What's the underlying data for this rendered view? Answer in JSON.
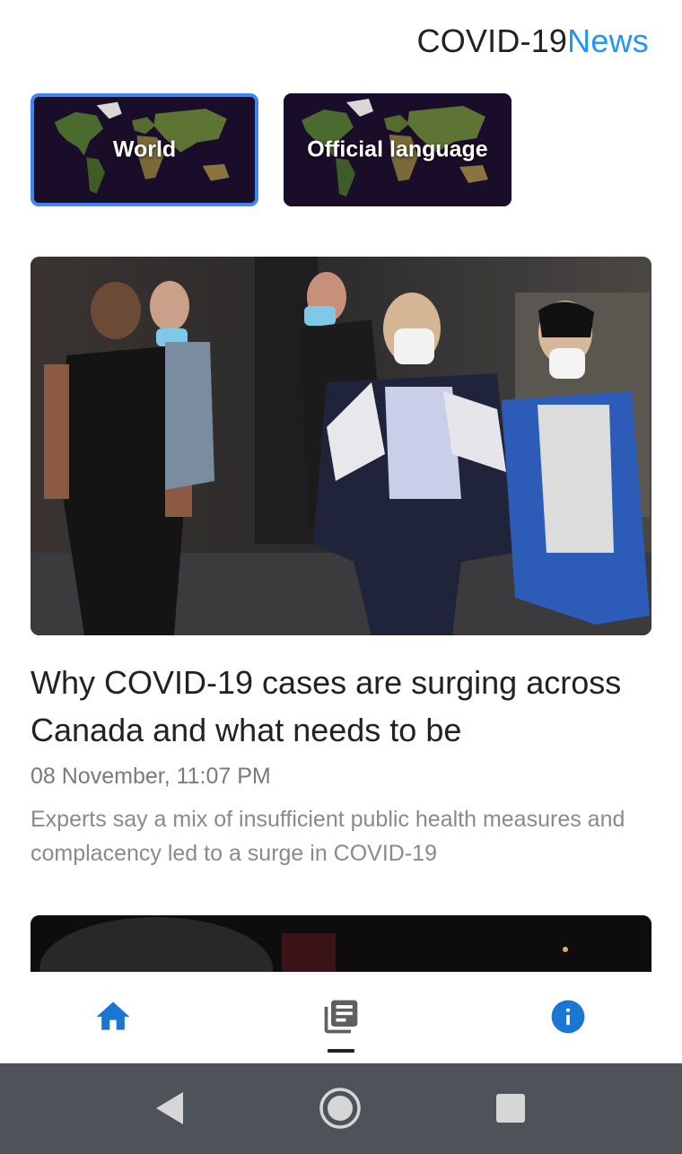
{
  "app": {
    "title_main": "COVID-19",
    "title_accent": "News",
    "accent_color": "#2196f3"
  },
  "regions": [
    {
      "label": "World",
      "selected": true
    },
    {
      "label": "Official language",
      "selected": false
    }
  ],
  "article": {
    "headline": "Why COVID-19 cases are surging across Canada and what needs to be",
    "date": "08 November, 11:07 PM",
    "excerpt": "Experts say a mix of insufficient public health measures and complacency led to a surge in COVID-19"
  },
  "bottom_nav": {
    "items": [
      {
        "icon": "home-icon",
        "active": false
      },
      {
        "icon": "newspaper-icon",
        "active": true
      },
      {
        "icon": "info-icon",
        "active": false
      }
    ],
    "active_color": "#1976d2"
  },
  "system_nav": {
    "buttons": [
      "back-icon",
      "home-circle-icon",
      "recents-icon"
    ]
  }
}
